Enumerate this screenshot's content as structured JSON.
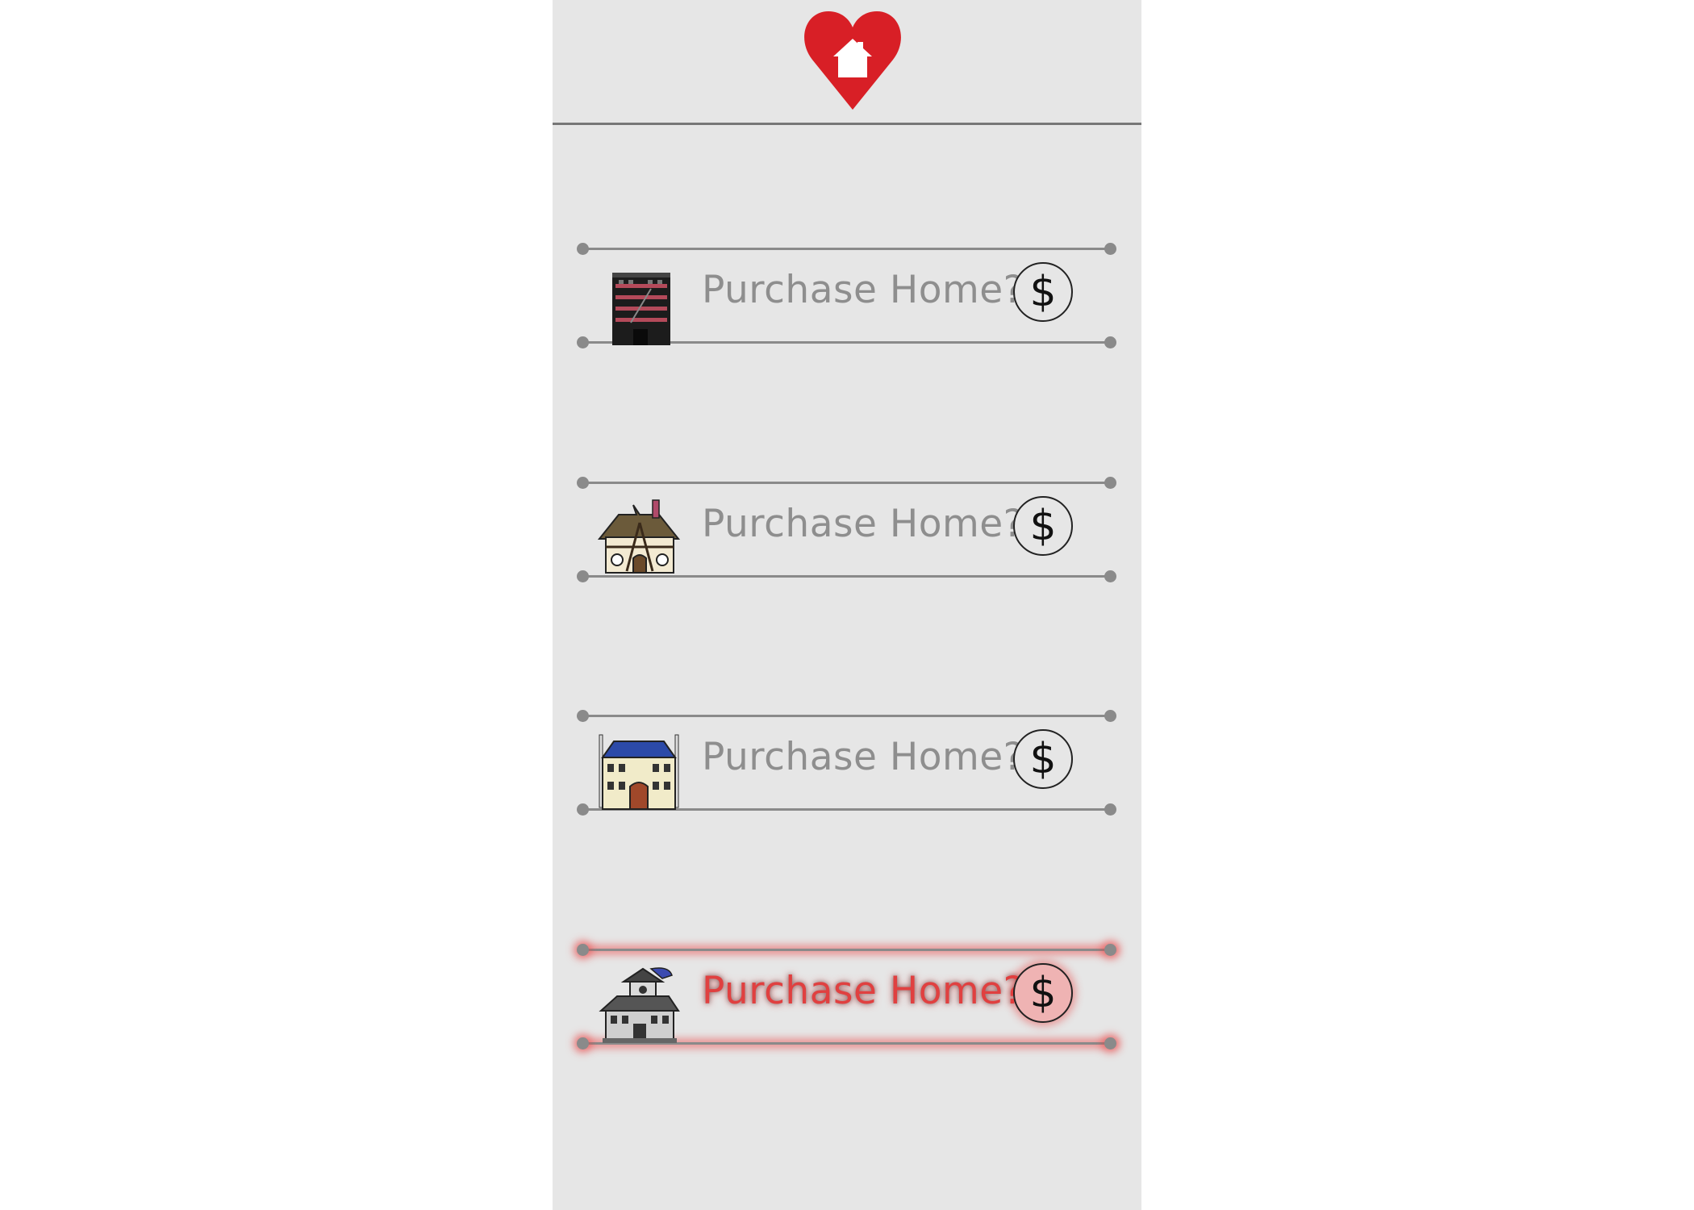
{
  "header": {
    "logo_icon": "heart-house-icon",
    "logo_color": "#d81f26"
  },
  "homes": [
    {
      "icon": "brick-apartment-icon",
      "label": "Purchase Home?",
      "button_glyph": "$",
      "active": false
    },
    {
      "icon": "tudor-cottage-icon",
      "label": "Purchase Home?",
      "button_glyph": "$",
      "active": false
    },
    {
      "icon": "blue-roof-mansion-icon",
      "label": "Purchase Home?",
      "button_glyph": "$",
      "active": false
    },
    {
      "icon": "haunted-house-icon",
      "label": "Purchase Home?",
      "button_glyph": "$",
      "active": true
    }
  ],
  "colors": {
    "panel": "#e6e6e6",
    "rail": "#8a8a8a",
    "highlight": "#e04040"
  }
}
